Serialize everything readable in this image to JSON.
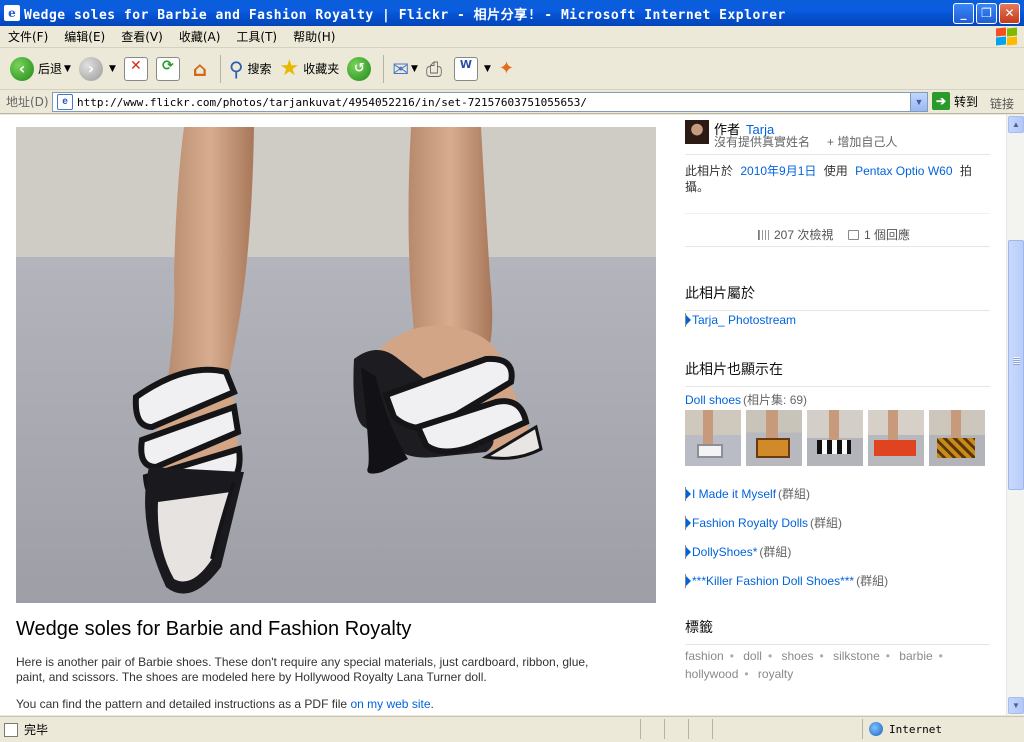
{
  "window": {
    "title": "Wedge soles for Barbie and Fashion Royalty | Flickr - 相片分享! - Microsoft Internet Explorer",
    "app_icon": "ie-icon"
  },
  "menu": [
    "文件(F)",
    "编辑(E)",
    "查看(V)",
    "收藏(A)",
    "工具(T)",
    "帮助(H)"
  ],
  "toolbar": {
    "back_label": "后退",
    "search_label": "搜索",
    "favorites_label": "收藏夹"
  },
  "address": {
    "label": "地址(D)",
    "url": "http://www.flickr.com/photos/tarjankuvat/4954052216/in/set-72157603751055653/",
    "go_label": "转到",
    "links_label": "链接"
  },
  "photo": {
    "title": "Wedge soles for Barbie and Fashion Royalty",
    "description": "Here is another pair of Barbie shoes. These don't require any special materials, just cardboard, ribbon, glue, paint, and scissors. The shoes are modeled here by Hollywood Royalty Lana Turner doll.",
    "pdf_text": "You can find the pattern and detailed instructions as a PDF file",
    "pdf_link": "on my web site",
    "pdf_end": "."
  },
  "sidebar": {
    "by_label": "作者",
    "author": "Tarja",
    "no_real_name": "沒有提供真實姓名",
    "add_me": "+ 增加自己人",
    "taken_prefix": "此相片於",
    "taken_date": "2010年9月1日",
    "taken_using": "使用",
    "camera": "Pentax Optio W60",
    "taken_suffix": "拍攝。",
    "views": "207 次檢視",
    "comments": "1 個回應",
    "belongs_heading": "此相片屬於",
    "photostream": "Tarja_ Photostream",
    "also_in_heading": "此相片也顯示在",
    "set_name": "Doll shoes",
    "set_kind": "(相片集: 69)",
    "groups": [
      {
        "name": "I Made it Myself",
        "kind": "(群組)"
      },
      {
        "name": "Fashion Royalty Dolls",
        "kind": "(群組)"
      },
      {
        "name": "DollyShoes*",
        "kind": "(群組)"
      },
      {
        "name": "***Killer Fashion Doll Shoes***",
        "kind": "(群組)"
      }
    ],
    "tags_heading": "標籤",
    "tags": [
      "fashion",
      "doll",
      "shoes",
      "silkstone",
      "barbie",
      "hollywood",
      "royalty"
    ]
  },
  "status": {
    "text": "完毕",
    "zone": "Internet"
  },
  "colors": {
    "link": "#0063dc",
    "titlebar": "#0a5fd9"
  }
}
